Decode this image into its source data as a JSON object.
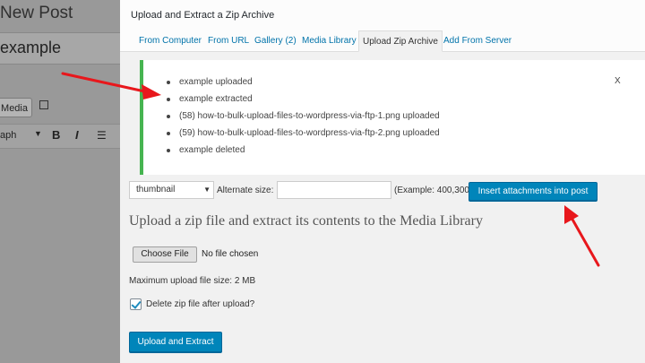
{
  "background": {
    "post_title": "New Post",
    "post_title_value": "example",
    "media_button_label": "Media",
    "format_select_label": "aph",
    "bold_label": "B",
    "italic_label": "I"
  },
  "modal": {
    "title": "Upload and Extract a Zip Archive",
    "tabs": [
      {
        "label": "From Computer",
        "active": false
      },
      {
        "label": "From URL",
        "active": false
      },
      {
        "label": "Gallery (2)",
        "active": false
      },
      {
        "label": "Media Library",
        "active": false
      },
      {
        "label": "Upload Zip Archive",
        "active": true
      },
      {
        "label": "Add From Server",
        "active": false
      }
    ],
    "notice": {
      "items": [
        "example uploaded",
        "example extracted",
        "(58) how-to-bulk-upload-files-to-wordpress-via-ftp-1.png uploaded",
        "(59) how-to-bulk-upload-files-to-wordpress-via-ftp-2.png uploaded",
        "example deleted"
      ],
      "close_label": "X"
    },
    "size_row": {
      "size_value": "thumbnail",
      "alt_label": "Alternate size:",
      "alt_value": "",
      "example_label": "(Example: 400,300)",
      "insert_button": "Insert attachments into post"
    },
    "upload": {
      "title": "Upload a zip file and extract its contents to the Media Library",
      "choose_file_button": "Choose File",
      "no_file_text": "No file chosen",
      "max_size_text": "Maximum upload file size: 2 MB",
      "delete_checkbox_label": "Delete zip file after upload?",
      "delete_checked": true,
      "submit_button": "Upload and Extract"
    }
  },
  "colors": {
    "accent": "#0085ba",
    "link": "#0073aa",
    "success": "#46b450",
    "annotation": "#e8171c"
  },
  "icons": [
    "chevron-down-icon",
    "checkmark-icon",
    "close-icon",
    "arrow-annotation-icon"
  ]
}
